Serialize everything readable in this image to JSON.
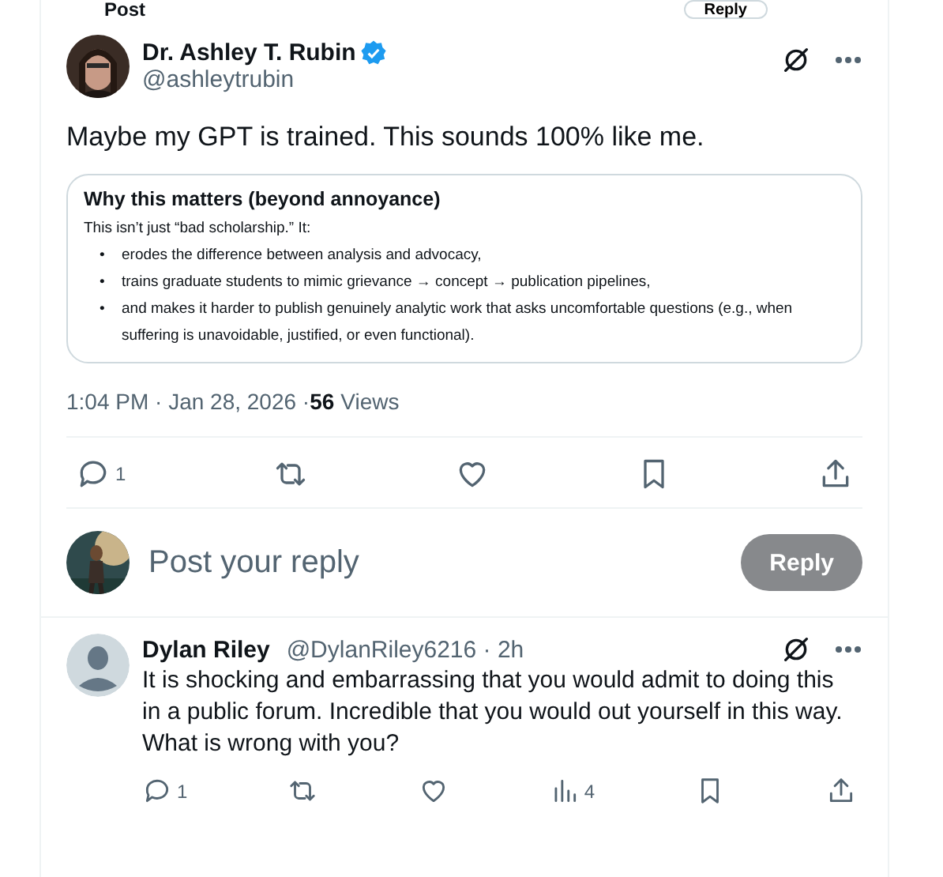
{
  "header": {
    "title": "Post",
    "reply_button": "Reply"
  },
  "post": {
    "author": {
      "name": "Dr. Ashley T. Rubin",
      "verified": true,
      "handle": "@ashleytrubin"
    },
    "text": "Maybe my GPT is trained. This sounds 100% like me.",
    "card": {
      "heading": "Why this matters (beyond annoyance)",
      "intro": "This isn’t just “bad scholarship.” It:",
      "bullet_mark": "•",
      "bullets": [
        "erodes the difference between analysis and advocacy,",
        "trains graduate students to mimic grievance → concept → publication pipelines,",
        "and makes it harder to publish genuinely analytic work that asks uncomfortable questions (e.g., when suffering is unavoidable, justified, or even functional)."
      ]
    },
    "time": "1:04 PM · Jan 28, 2026 · ",
    "views_count": "56",
    "views_label": "Views",
    "actions": [
      {
        "kind": "reply",
        "count": "1"
      },
      {
        "kind": "repost"
      },
      {
        "kind": "like"
      },
      {
        "kind": "bookmark"
      },
      {
        "kind": "share"
      }
    ]
  },
  "composer": {
    "placeholder": "Post your reply",
    "button": "Reply",
    "disabled": true
  },
  "replies": [
    {
      "name": "Dylan Riley",
      "handle": "@DylanRiley6216 · 2h",
      "text": "It is shocking and embarrassing that you would admit to doing this in a public forum. Incredible that you would out yourself in this way. What is wrong with you?",
      "actions": [
        {
          "kind": "reply",
          "count": "1"
        },
        {
          "kind": "repost"
        },
        {
          "kind": "like"
        },
        {
          "kind": "views",
          "count": "4"
        },
        {
          "kind": "bookmark"
        },
        {
          "kind": "share"
        }
      ]
    }
  ]
}
